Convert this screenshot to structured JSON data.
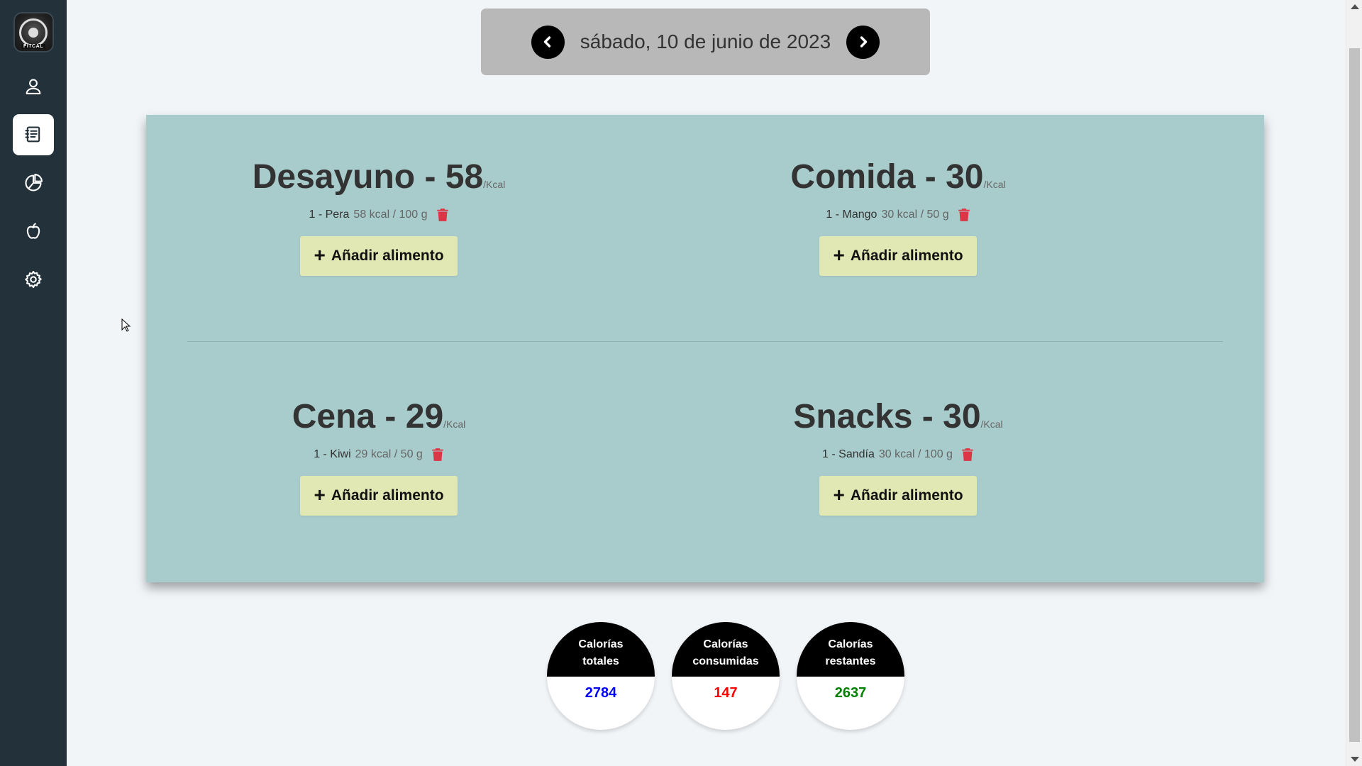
{
  "sidebar": {
    "logo_text": "FITCAL",
    "items": [
      {
        "name": "profile",
        "icon": "user-icon"
      },
      {
        "name": "diary",
        "icon": "journal-icon",
        "active": true
      },
      {
        "name": "stats",
        "icon": "pie-chart-icon"
      },
      {
        "name": "foods",
        "icon": "apple-icon"
      },
      {
        "name": "settings",
        "icon": "gear-icon"
      }
    ]
  },
  "date_nav": {
    "date": "sábado, 10 de junio de 2023",
    "prev_icon": "chevron-left-icon",
    "next_icon": "chevron-right-icon"
  },
  "meals": [
    {
      "title": "Desayuno - 58",
      "unit": "/Kcal",
      "food": "1 - Pera",
      "meta": "58 kcal / 100 g",
      "add_label": "Añadir alimento"
    },
    {
      "title": "Comida - 30",
      "unit": "/Kcal",
      "food": "1 - Mango",
      "meta": "30 kcal / 50 g",
      "add_label": "Añadir alimento"
    },
    {
      "title": "Cena - 29",
      "unit": "/Kcal",
      "food": "1 - Kiwi",
      "meta": "29 kcal / 50 g",
      "add_label": "Añadir alimento"
    },
    {
      "title": "Snacks - 30",
      "unit": "/Kcal",
      "food": "1 - Sandía",
      "meta": "30 kcal / 100 g",
      "add_label": "Añadir alimento"
    }
  ],
  "calories": {
    "total": {
      "label": "Calorías totales",
      "value": "2784",
      "color": "#0000ff"
    },
    "consumed": {
      "label": "Calorías consumidas",
      "value": "147",
      "color": "#ff0000"
    },
    "remaining": {
      "label": "Calorías restantes",
      "value": "2637",
      "color": "#008000"
    }
  },
  "colors": {
    "sidebar": "#22313a",
    "card": "#a8cbcb",
    "add_button": "#e1e8b3",
    "trash": "#dc3545"
  }
}
